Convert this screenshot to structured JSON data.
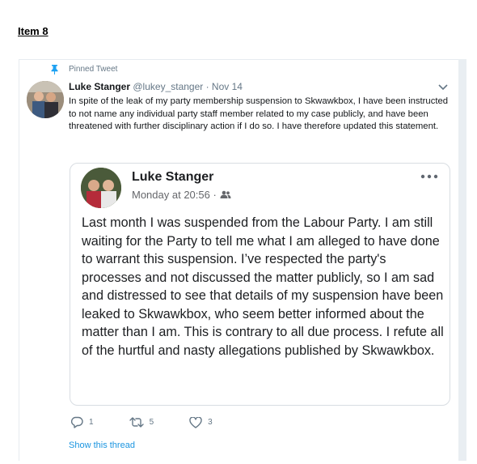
{
  "document": {
    "heading": "Item 8"
  },
  "tweet": {
    "pinned_label": "Pinned Tweet",
    "author_name": "Luke Stanger",
    "author_meta": "@lukey_stanger · Nov 14",
    "text": "In spite of the leak of my party membership suspension to Skwawkbox, I have been instructed to not name any individual party staff member related to my case publicly, and have been threatened with further disciplinary action if I do so. I have therefore updated this statement.",
    "embedded_post": {
      "author_name": "Luke Stanger",
      "timestamp": "Monday at 20:56 ·",
      "text": "Last month I was suspended from the Labour Party. I am still waiting for the Party to tell me what I am alleged to have done to warrant this suspension. I’ve respected the party's processes and not discussed the matter publicly, so I am sad and distressed to see that details of my suspension have been leaked to Skwawkbox, who seem better informed about the matter than I am. This is contrary to all due process. I refute all of the hurtful and nasty allegations published by Skwawkbox."
    },
    "actions": {
      "reply_count": "1",
      "retweet_count": "5",
      "like_count": "3"
    },
    "show_thread_label": "Show this thread"
  },
  "colors": {
    "link": "#1b95e0",
    "muted": "#657786",
    "pin": "#1da1f2"
  },
  "icons": [
    "pin-icon",
    "chevron-down-icon",
    "more-horizontal-icon",
    "friends-icon",
    "reply-icon",
    "retweet-icon",
    "like-icon"
  ]
}
